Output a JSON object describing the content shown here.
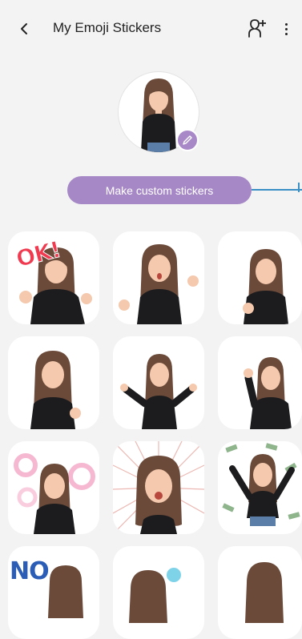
{
  "header": {
    "title": "My Emoji Stickers",
    "back_icon": "chevron-left-icon",
    "add_icon": "add-person-icon",
    "more_icon": "more-vertical-icon"
  },
  "profile": {
    "edit_icon": "pencil-icon"
  },
  "actions": {
    "make_custom_label": "Make custom stickers"
  },
  "stickers": {
    "ok_text": "OK!",
    "no_text": "NO"
  },
  "colors": {
    "accent": "#a688c6",
    "callout": "#3a8fc4",
    "background": "#f3f3f3",
    "hair": "#6b4a3a",
    "shirt": "#1c1c1e",
    "skin": "#f4c9ad"
  }
}
